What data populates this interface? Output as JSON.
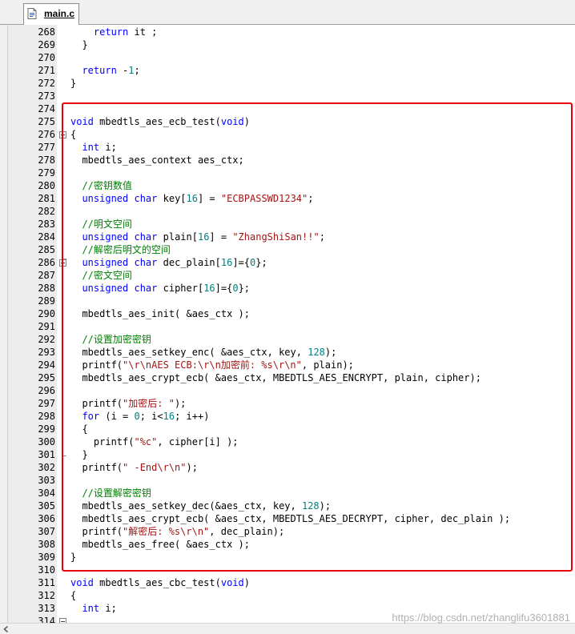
{
  "tab": {
    "label": "main.c",
    "icon": "c-source-file-icon"
  },
  "code_lines": [
    {
      "n": "268",
      "t": [
        [
          "    ",
          ""
        ],
        [
          "return",
          "kw"
        ],
        [
          " it ;",
          ""
        ]
      ]
    },
    {
      "n": "269",
      "t": [
        [
          "  }",
          ""
        ]
      ]
    },
    {
      "n": "270",
      "t": []
    },
    {
      "n": "271",
      "t": [
        [
          "  ",
          ""
        ],
        [
          "return",
          "kw"
        ],
        [
          " -",
          ""
        ],
        [
          "1",
          "num"
        ],
        [
          ";",
          ""
        ]
      ]
    },
    {
      "n": "272",
      "t": [
        [
          "}",
          ""
        ]
      ]
    },
    {
      "n": "273",
      "t": []
    },
    {
      "n": "274",
      "t": []
    },
    {
      "n": "275",
      "t": [
        [
          "void",
          "kw"
        ],
        [
          " mbedtls_aes_ecb_test(",
          ""
        ],
        [
          "void",
          "kw"
        ],
        [
          ")",
          ""
        ]
      ]
    },
    {
      "n": "276",
      "t": [
        [
          "{",
          ""
        ]
      ]
    },
    {
      "n": "277",
      "t": [
        [
          "  ",
          ""
        ],
        [
          "int",
          "kw"
        ],
        [
          " i;",
          ""
        ]
      ]
    },
    {
      "n": "278",
      "t": [
        [
          "  mbedtls_aes_context aes_ctx;",
          ""
        ]
      ]
    },
    {
      "n": "279",
      "t": []
    },
    {
      "n": "280",
      "t": [
        [
          "  ",
          ""
        ],
        [
          "//密钥数值",
          "cmt"
        ]
      ]
    },
    {
      "n": "281",
      "t": [
        [
          "  ",
          ""
        ],
        [
          "unsigned",
          "kw"
        ],
        [
          " ",
          ""
        ],
        [
          "char",
          "kw"
        ],
        [
          " key[",
          ""
        ],
        [
          "16",
          "num"
        ],
        [
          "] = ",
          ""
        ],
        [
          "\"ECBPASSWD1234\"",
          "str"
        ],
        [
          ";",
          ""
        ]
      ]
    },
    {
      "n": "282",
      "t": []
    },
    {
      "n": "283",
      "t": [
        [
          "  ",
          ""
        ],
        [
          "//明文空间",
          "cmt"
        ]
      ]
    },
    {
      "n": "284",
      "t": [
        [
          "  ",
          ""
        ],
        [
          "unsigned",
          "kw"
        ],
        [
          " ",
          ""
        ],
        [
          "char",
          "kw"
        ],
        [
          " plain[",
          ""
        ],
        [
          "16",
          "num"
        ],
        [
          "] = ",
          ""
        ],
        [
          "\"ZhangShiSan!!\"",
          "str"
        ],
        [
          ";",
          ""
        ]
      ]
    },
    {
      "n": "285",
      "t": [
        [
          "  ",
          ""
        ],
        [
          "//解密后明文的空间",
          "cmt"
        ]
      ]
    },
    {
      "n": "286",
      "t": [
        [
          "  ",
          ""
        ],
        [
          "unsigned",
          "kw"
        ],
        [
          " ",
          ""
        ],
        [
          "char",
          "kw"
        ],
        [
          " dec_plain[",
          ""
        ],
        [
          "16",
          "num"
        ],
        [
          "]={",
          ""
        ],
        [
          "0",
          "num"
        ],
        [
          "};",
          ""
        ]
      ]
    },
    {
      "n": "287",
      "t": [
        [
          "  ",
          ""
        ],
        [
          "//密文空间",
          "cmt"
        ]
      ]
    },
    {
      "n": "288",
      "t": [
        [
          "  ",
          ""
        ],
        [
          "unsigned",
          "kw"
        ],
        [
          " ",
          ""
        ],
        [
          "char",
          "kw"
        ],
        [
          " cipher[",
          ""
        ],
        [
          "16",
          "num"
        ],
        [
          "]={",
          ""
        ],
        [
          "0",
          "num"
        ],
        [
          "};",
          ""
        ]
      ]
    },
    {
      "n": "289",
      "t": []
    },
    {
      "n": "290",
      "t": [
        [
          "  mbedtls_aes_init( &aes_ctx );",
          ""
        ]
      ]
    },
    {
      "n": "291",
      "t": []
    },
    {
      "n": "292",
      "t": [
        [
          "  ",
          ""
        ],
        [
          "//设置加密密钥",
          "cmt"
        ]
      ]
    },
    {
      "n": "293",
      "t": [
        [
          "  mbedtls_aes_setkey_enc( &aes_ctx, key, ",
          ""
        ],
        [
          "128",
          "num"
        ],
        [
          ");",
          ""
        ]
      ]
    },
    {
      "n": "294",
      "t": [
        [
          "  printf(",
          ""
        ],
        [
          "\"\\r\\nAES ECB:\\r\\n加密前: %s\\r\\n\"",
          "str"
        ],
        [
          ", plain);",
          ""
        ]
      ]
    },
    {
      "n": "295",
      "t": [
        [
          "  mbedtls_aes_crypt_ecb( &aes_ctx, MBEDTLS_AES_ENCRYPT, plain, cipher);",
          ""
        ]
      ]
    },
    {
      "n": "296",
      "t": []
    },
    {
      "n": "297",
      "t": [
        [
          "  printf(",
          ""
        ],
        [
          "\"加密后: \"",
          "str"
        ],
        [
          ");",
          ""
        ]
      ]
    },
    {
      "n": "298",
      "t": [
        [
          "  ",
          ""
        ],
        [
          "for",
          "kw"
        ],
        [
          " (i = ",
          ""
        ],
        [
          "0",
          "num"
        ],
        [
          "; i<",
          ""
        ],
        [
          "16",
          "num"
        ],
        [
          "; i++)",
          ""
        ]
      ]
    },
    {
      "n": "299",
      "t": [
        [
          "  {",
          ""
        ]
      ]
    },
    {
      "n": "300",
      "t": [
        [
          "    printf(",
          ""
        ],
        [
          "\"%c\"",
          "str"
        ],
        [
          ", cipher[i] );",
          ""
        ]
      ]
    },
    {
      "n": "301",
      "t": [
        [
          "  }",
          ""
        ]
      ]
    },
    {
      "n": "302",
      "t": [
        [
          "  printf(",
          ""
        ],
        [
          "\" -End\\r\\n\"",
          "str"
        ],
        [
          ");",
          ""
        ]
      ]
    },
    {
      "n": "303",
      "t": []
    },
    {
      "n": "304",
      "t": [
        [
          "  ",
          ""
        ],
        [
          "//设置解密密钥",
          "cmt"
        ]
      ]
    },
    {
      "n": "305",
      "t": [
        [
          "  mbedtls_aes_setkey_dec(&aes_ctx, key, ",
          ""
        ],
        [
          "128",
          "num"
        ],
        [
          ");",
          ""
        ]
      ]
    },
    {
      "n": "306",
      "t": [
        [
          "  mbedtls_aes_crypt_ecb( &aes_ctx, MBEDTLS_AES_DECRYPT, cipher, dec_plain );",
          ""
        ]
      ]
    },
    {
      "n": "307",
      "t": [
        [
          "  printf(",
          ""
        ],
        [
          "\"解密后: %s\\r\\n\"",
          "str"
        ],
        [
          ", dec_plain);",
          ""
        ]
      ]
    },
    {
      "n": "308",
      "t": [
        [
          "  mbedtls_aes_free( &aes_ctx );",
          ""
        ]
      ]
    },
    {
      "n": "309",
      "t": [
        [
          "}",
          ""
        ]
      ]
    },
    {
      "n": "310",
      "t": []
    },
    {
      "n": "311",
      "t": [
        [
          "void",
          "kw"
        ],
        [
          " mbedtls_aes_cbc_test(",
          ""
        ],
        [
          "void",
          "kw"
        ],
        [
          ")",
          ""
        ]
      ]
    },
    {
      "n": "312",
      "t": [
        [
          "{",
          ""
        ]
      ]
    },
    {
      "n": "313",
      "t": [
        [
          "  ",
          ""
        ],
        [
          "int",
          "kw"
        ],
        [
          " i;",
          ""
        ]
      ]
    },
    {
      "n": "314",
      "t": []
    }
  ],
  "watermark": "https://blog.csdn.net/zhanglifu3601881",
  "colors": {
    "keyword": "#0000ff",
    "comment": "#008000",
    "string": "#a31515",
    "number": "#008080",
    "highlight": "#e8000b"
  },
  "icons": {
    "scroll_left": "arrow-left-icon",
    "fold": "fold-minus-icon"
  }
}
